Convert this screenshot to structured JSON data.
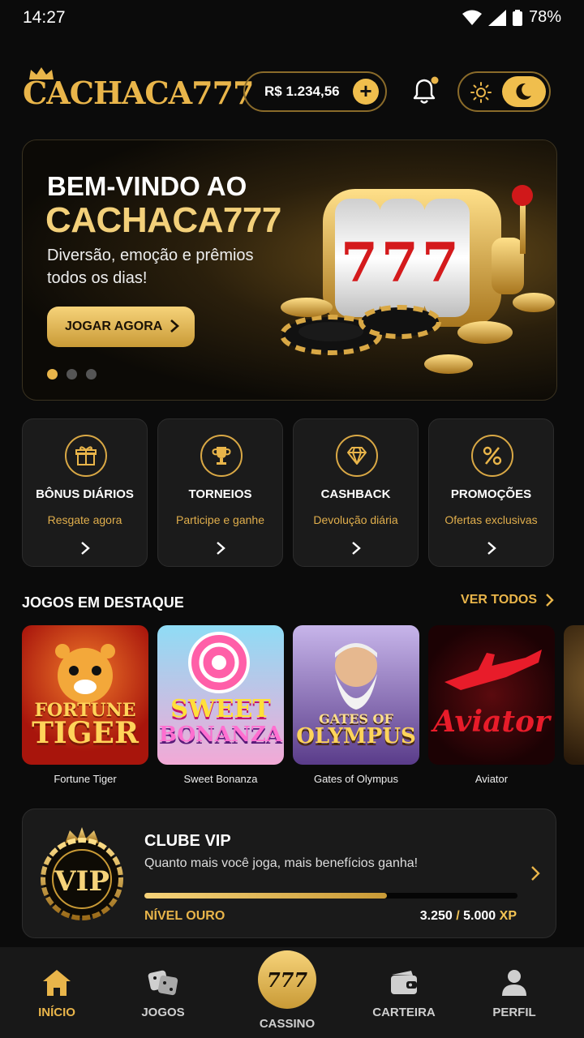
{
  "status": {
    "time": "14:27",
    "battery": "78%"
  },
  "header": {
    "logo_text": "CACHACA777",
    "balance": "R$ 1.234,56",
    "add_label": "+"
  },
  "banner": {
    "line1": "BEM-VINDO AO",
    "line2": "CACHACA777",
    "text": "Diversão, emoção e prêmios todos os dias!",
    "cta": "JOGAR AGORA",
    "slot_label": "777",
    "active_slide": 1,
    "slides": 3
  },
  "features": [
    {
      "title": "BÔNUS DIÁRIOS",
      "subtitle": "Resgate agora",
      "icon": "gift-icon"
    },
    {
      "title": "TORNEIOS",
      "subtitle": "Participe e ganhe",
      "icon": "trophy-icon"
    },
    {
      "title": "CASHBACK",
      "subtitle": "Devolução diária",
      "icon": "diamond-icon"
    },
    {
      "title": "PROMOÇÕES",
      "subtitle": "Ofertas exclusivas",
      "icon": "percent-icon"
    }
  ],
  "featured": {
    "title": "JOGOS EM DESTAQUE",
    "see_all": "VER TODOS",
    "games": [
      {
        "name": "Fortune Tiger",
        "art_line1": "FORTUNE",
        "art_line2": "TIGER",
        "bg1": "#d23a1a",
        "bg2": "#7a0f08"
      },
      {
        "name": "Sweet Bonanza",
        "art_line1": "SWEET",
        "art_line2": "BONANZA",
        "bg1": "#7fd3f0",
        "bg2": "#f19ad1"
      },
      {
        "name": "Gates of Olympus",
        "art_line1": "GATES OF",
        "art_line2": "OLYMPUS",
        "bg1": "#b9a4e0",
        "bg2": "#5a3c8a"
      },
      {
        "name": "Aviator",
        "art_line1": "",
        "art_line2": "Aviator",
        "bg1": "#3a0608",
        "bg2": "#1a0203"
      }
    ]
  },
  "vip": {
    "badge": "VIP",
    "title": "CLUBE VIP",
    "description": "Quanto mais você joga, mais benefícios ganha!",
    "level": "NÍVEL OURO",
    "xp_current": "3.250",
    "xp_sep": "/",
    "xp_total": "5.000",
    "xp_unit": "XP",
    "progress": 0.65
  },
  "nav": {
    "items": [
      {
        "label": "INÍCIO",
        "icon": "home-icon",
        "active": true
      },
      {
        "label": "JOGOS",
        "icon": "dice-icon",
        "active": false
      },
      {
        "label": "CASSINO",
        "icon": "777",
        "active": false
      },
      {
        "label": "CARTEIRA",
        "icon": "wallet-icon",
        "active": false
      },
      {
        "label": "PERFIL",
        "icon": "user-icon",
        "active": false
      }
    ]
  },
  "colors": {
    "accent": "#e9b54a",
    "background": "#0b0b0b",
    "card": "#1b1b1b"
  }
}
